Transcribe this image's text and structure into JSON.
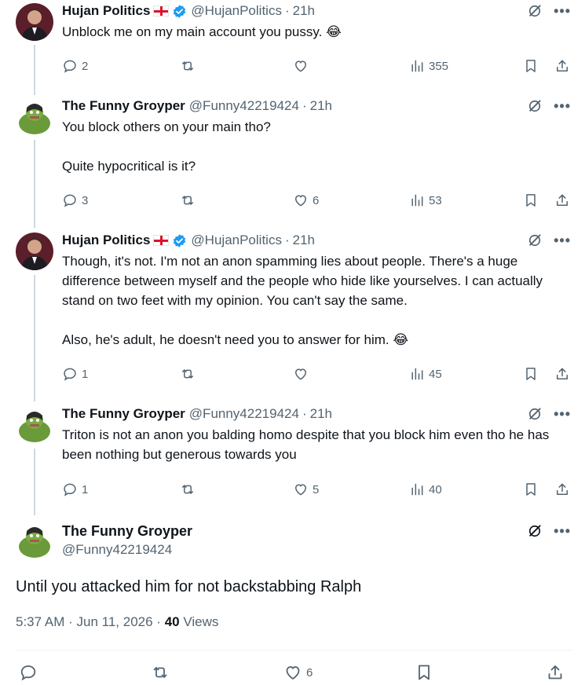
{
  "tweets": [
    {
      "name": "Hujan Politics",
      "handle": "@HujanPolitics",
      "time": "21h",
      "text": "Unblock me on my main account you pussy. 😂",
      "replies": "2",
      "retweets": "",
      "likes": "",
      "views": "355"
    },
    {
      "name": "The Funny Groyper",
      "handle": "@Funny42219424",
      "time": "21h",
      "text": "You block others on your main tho?\n\nQuite hypocritical is it?",
      "replies": "3",
      "retweets": "",
      "likes": "6",
      "views": "53"
    },
    {
      "name": "Hujan Politics",
      "handle": "@HujanPolitics",
      "time": "21h",
      "text": "Though, it's not. I'm not an anon spamming lies about people. There's a huge difference between myself and the people who hide like yourselves. I can actually stand on two feet with my opinion. You can't say the same.\n\nAlso, he's adult, he doesn't need you to answer for him. 😂",
      "replies": "1",
      "retweets": "",
      "likes": "",
      "views": "45"
    },
    {
      "name": "The Funny Groyper",
      "handle": "@Funny42219424",
      "time": "21h",
      "text": "Triton is not an anon you balding homo despite that you block him even tho he has been nothing but generous towards you",
      "replies": "1",
      "retweets": "",
      "likes": "5",
      "views": "40"
    }
  ],
  "focus": {
    "name": "The Funny Groyper",
    "handle": "@Funny42219424",
    "text": "Until you attacked him for not backstabbing Ralph",
    "time": "5:37 AM",
    "date": "Jun 11, 2026",
    "views_count": "40",
    "views_label": "Views",
    "likes": "6"
  },
  "separator": "·",
  "icons": [
    "reply-icon",
    "retweet-icon",
    "like-icon",
    "views-icon",
    "bookmark-icon",
    "share-icon",
    "grok-icon",
    "more-icon",
    "verified-icon",
    "england-flag"
  ],
  "colors": {
    "text": "#0f1419",
    "secondary": "#536471",
    "verified": "#1d9bf0",
    "thread_line": "#cfd9de",
    "flag_red": "#d8142a"
  }
}
